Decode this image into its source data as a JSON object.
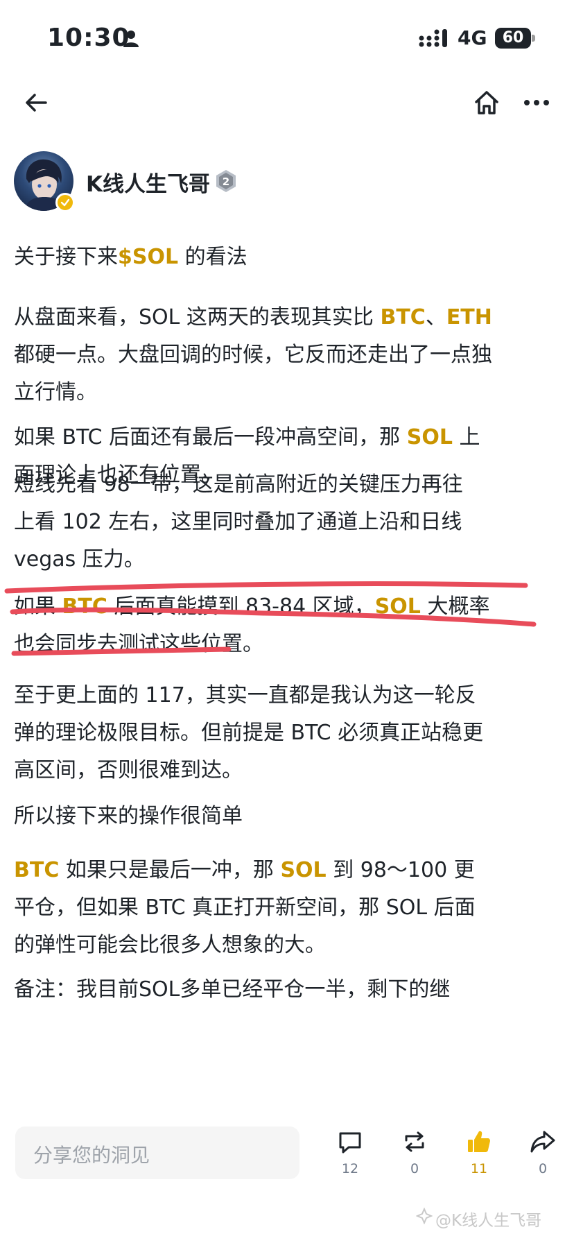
{
  "status_bar": {
    "time": "10:30",
    "network": "4G",
    "battery": "60"
  },
  "nav": {
    "back_icon": "arrow-left-icon",
    "home_icon": "home-icon",
    "more_icon": "more-horizontal-icon"
  },
  "author": {
    "name": "K线人生飞哥",
    "level": "2",
    "verified": true
  },
  "post": {
    "p1": {
      "pre": "关于接下来",
      "tag": "$SOL",
      "post": " 的看法"
    },
    "p2": {
      "a": "从盘面来看，SOL 这两天的表现其实比 ",
      "btc": "BTC",
      "b": "、",
      "eth": "ETH",
      "c": " 都硬一点。大盘回调的时候，它反而还走出了一点独立行情。"
    },
    "p3": {
      "a": "如果 BTC 后面还有最后一段冲高空间，那 ",
      "sol": "SOL",
      "b": " 上面理论上也还有位置。"
    },
    "p4": "短线先看 98一带，这是前高附近的关键压力再往上看 102 左右，这里同时叠加了通道上沿和日线 vegas 压力。",
    "p5": {
      "a": "如果 ",
      "btc": "BTC",
      "b": " 后面真能摸到 83-84 区域，",
      "sol": "SOL",
      "c": " 大概率也会同步去测试这些位置。"
    },
    "p6": "至于更上面的 117，其实一直都是我认为这一轮反弹的理论极限目标。但前提是 BTC 必须真正站稳更高区间，否则很难到达。",
    "p7": "所以接下来的操作很简单",
    "p8": {
      "btc": "BTC",
      "a": " 如果只是最后一冲，那 ",
      "sol": "SOL",
      "b": " 到 98～100 更平仓，但如果 BTC 真正打开新空间，那 SOL 后面的弹性可能会比很多人想象的大。"
    },
    "p9_partial": "备注：我目前SOL多单已经平仓一半，剩下的继"
  },
  "bottom_bar": {
    "share_placeholder": "分享您的洞见",
    "comments": "12",
    "reposts": "0",
    "likes": "11",
    "shares": "0"
  },
  "watermark": "@K线人生飞哥",
  "colors": {
    "accent": "#c99400",
    "text": "#1e2329",
    "underline": "#e84c5a"
  }
}
